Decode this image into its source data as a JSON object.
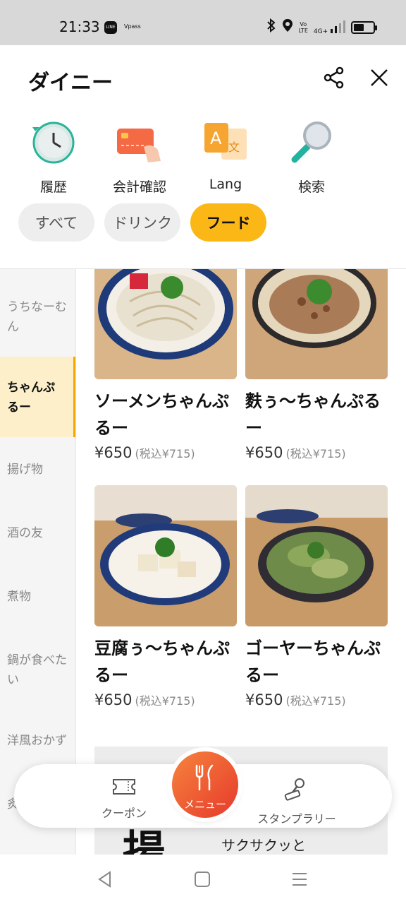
{
  "status_bar": {
    "time": "21:33",
    "line_badge": "LINE",
    "vpass_label": "Vpass",
    "volte": "Vo\nLTE",
    "network": "4G+",
    "battery_level": 0.55,
    "icons": [
      "bluetooth-icon",
      "location-icon",
      "signal-icon",
      "battery-icon"
    ]
  },
  "header": {
    "title": "ダイニー",
    "icons": [
      "share-icon",
      "close-icon"
    ]
  },
  "quick_actions": [
    {
      "label": "履歴",
      "icon": "history-clock-icon"
    },
    {
      "label": "会計確認",
      "icon": "payment-card-icon"
    },
    {
      "label": "Lang",
      "icon": "language-icon"
    },
    {
      "label": "検索",
      "icon": "search-icon"
    }
  ],
  "lang_icon_letters": {
    "latin": "A",
    "jp": "文"
  },
  "category_tabs": [
    {
      "label": "すべて",
      "active": false
    },
    {
      "label": "ドリンク",
      "active": false
    },
    {
      "label": "フード",
      "active": true
    }
  ],
  "sidebar": {
    "items": [
      {
        "label": "うちなーむん",
        "active": false
      },
      {
        "label": "ちゃんぷるー",
        "active": true
      },
      {
        "label": "揚げ物",
        "active": false
      },
      {
        "label": "酒の友",
        "active": false
      },
      {
        "label": "煮物",
        "active": false
      },
      {
        "label": "鍋が食べたい",
        "active": false
      },
      {
        "label": "洋風おかず",
        "active": false
      },
      {
        "label": "炙",
        "active": false
      }
    ]
  },
  "menu_items": [
    {
      "name": "ソーメンちゃんぷるー",
      "price": "¥650",
      "tax_price": "(税込¥715)"
    },
    {
      "name": "麩ぅ〜ちゃんぷるー",
      "price": "¥650",
      "tax_price": "(税込¥715)"
    },
    {
      "name": "豆腐ぅ〜ちゃんぷるー",
      "price": "¥650",
      "tax_price": "(税込¥715)"
    },
    {
      "name": "ゴーヤーちゃんぷるー",
      "price": "¥650",
      "tax_price": "(税込¥715)"
    }
  ],
  "banner": {
    "big_char": "揚",
    "text": "サクサクッと"
  },
  "bottom_nav": {
    "coupon": {
      "label": "クーポン",
      "icon": "ticket-icon"
    },
    "menu": {
      "label": "メニュー",
      "icon": "fork-knife-icon"
    },
    "stamp": {
      "label": "スタンプラリー",
      "icon": "stamp-icon"
    }
  },
  "system_nav": [
    "back-icon",
    "home-icon",
    "recents-icon"
  ],
  "colors": {
    "accent": "#fbb715",
    "active_sidebar_bg": "#fcefc9",
    "fab_start": "#f7843d",
    "fab_end": "#e6392c"
  }
}
